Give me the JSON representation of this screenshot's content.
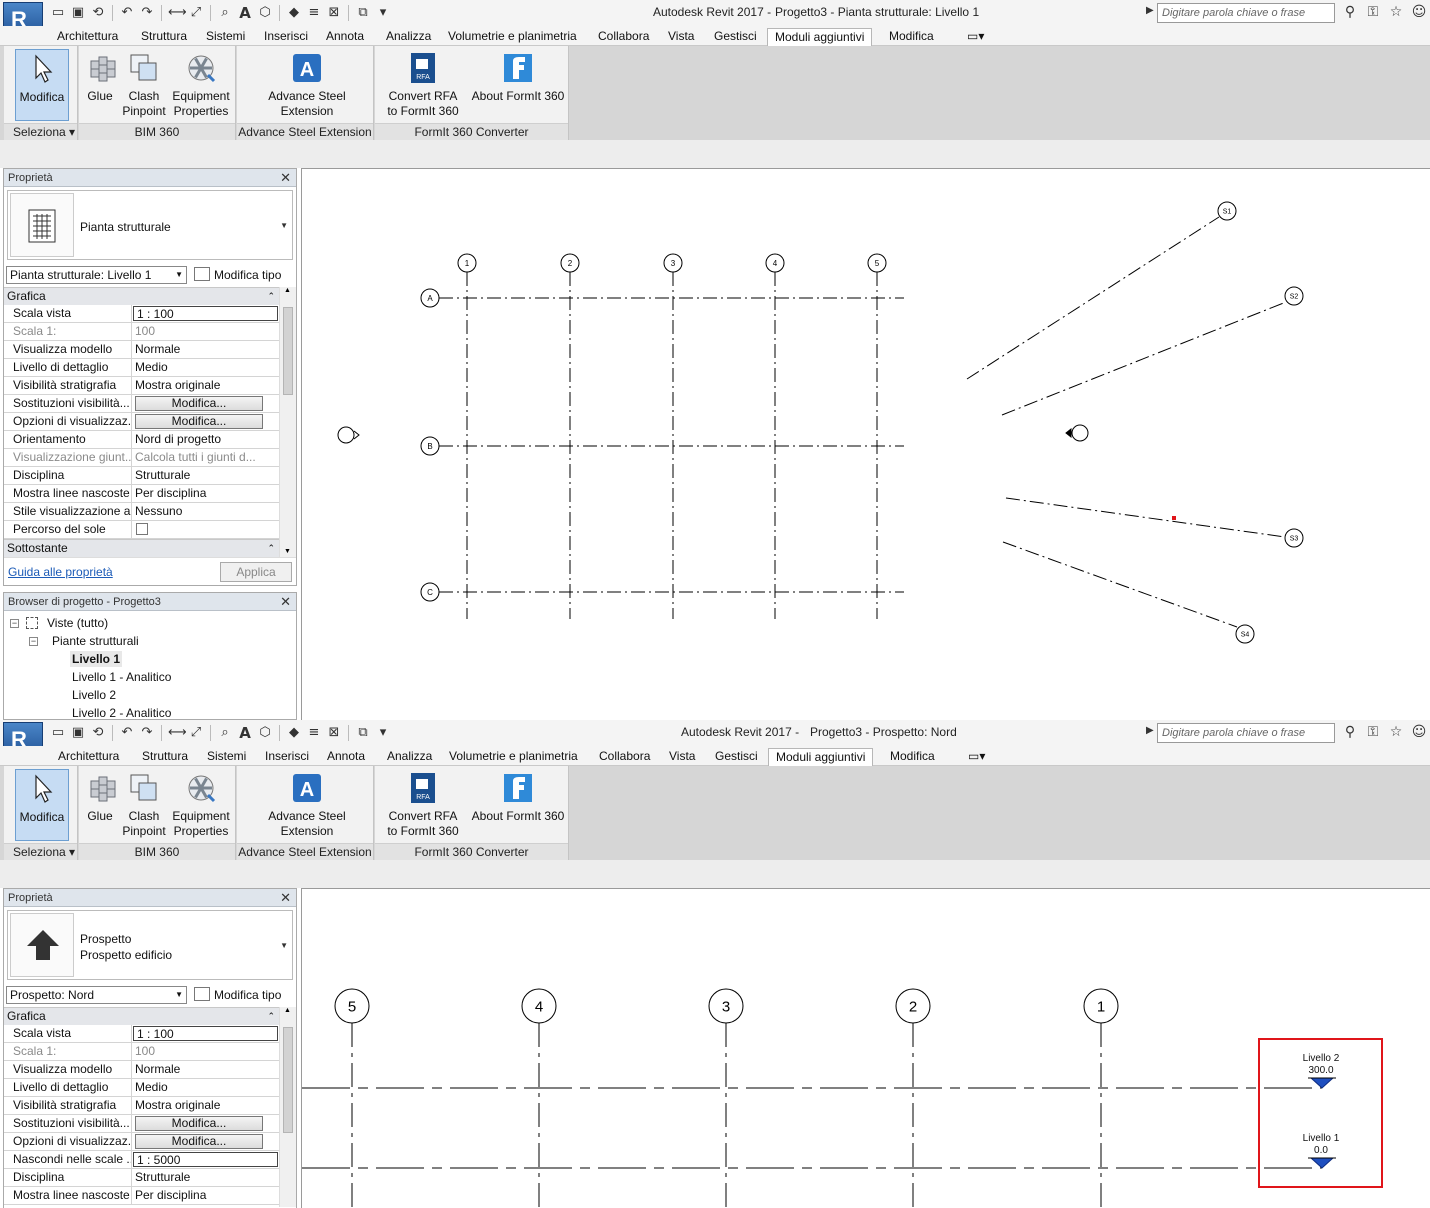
{
  "app": {
    "qat_icons": [
      "open-icon",
      "save-icon",
      "sync-icon",
      "undo-icon",
      "redo-icon",
      "measure-icon",
      "align-dimension-icon",
      "tag-icon",
      "text-icon",
      "3d-view-icon",
      "section-icon",
      "thin-lines-icon",
      "close-hidden-icon",
      "switch-windows-icon"
    ],
    "search_placeholder": "Digitare parola chiave o frase",
    "tabs": [
      "Architettura",
      "Struttura",
      "Sistemi",
      "Inserisci",
      "Annota",
      "Analizza",
      "Volumetrie e planimetria",
      "Collabora",
      "Vista",
      "Gestisci",
      "Moduli aggiuntivi",
      "Modifica"
    ],
    "active_tab": "Moduli aggiuntivi",
    "ribbon": {
      "modify": "Modifica",
      "select_panel": "Seleziona",
      "glue": "Glue",
      "clash_1": "Clash",
      "clash_2": "Pinpoint",
      "equip_1": "Equipment",
      "equip_2": "Properties",
      "bim360_panel": "BIM 360",
      "advsteel_1": "Advance Steel",
      "advsteel_2": "Extension",
      "advsteel_panel": "Advance Steel Extension",
      "convert_1": "Convert RFA",
      "convert_2": "to FormIt 360",
      "about": "About FormIt 360",
      "formit_panel": "FormIt 360 Converter"
    }
  },
  "top": {
    "title_app": "Autodesk Revit 2017 -",
    "title_doc": "Progetto3 - Pianta strutturale: Livello 1",
    "properties": {
      "header": "Proprietà",
      "type_name": "Pianta strutturale",
      "instance": "Pianta strutturale: Livello 1",
      "edit_type": "Modifica tipo",
      "group_graphics": "Grafica",
      "rows": [
        {
          "k": "Scala vista",
          "v": "1 : 100",
          "kind": "input"
        },
        {
          "k": "Scala 1:",
          "v": "100",
          "kind": "dis"
        },
        {
          "k": "Visualizza modello",
          "v": "Normale"
        },
        {
          "k": "Livello di dettaglio",
          "v": "Medio"
        },
        {
          "k": "Visibilità stratigrafia",
          "v": "Mostra originale"
        },
        {
          "k": "Sostituzioni visibilità...",
          "v": "Modifica...",
          "kind": "btn"
        },
        {
          "k": "Opzioni di visualizzaz...",
          "v": "Modifica...",
          "kind": "btn"
        },
        {
          "k": "Orientamento",
          "v": "Nord di progetto"
        },
        {
          "k": "Visualizzazione giunt...",
          "v": "Calcola tutti i giunti d...",
          "kind": "dis"
        },
        {
          "k": "Disciplina",
          "v": "Strutturale"
        },
        {
          "k": "Mostra linee nascoste",
          "v": "Per disciplina"
        },
        {
          "k": "Stile visualizzazione a...",
          "v": "Nessuno"
        },
        {
          "k": "Percorso del sole",
          "v": "",
          "kind": "chk"
        }
      ],
      "group_underlay": "Sottostante",
      "help_link": "Guida alle proprietà",
      "apply": "Applica"
    },
    "browser": {
      "header": "Browser di progetto - Progetto3",
      "views": "Viste (tutto)",
      "plans": "Piante strutturali",
      "items": [
        "Livello 1",
        "Livello 1 - Analitico",
        "Livello 2",
        "Livello 2 - Analitico"
      ]
    },
    "grid_cols": [
      "1",
      "2",
      "3",
      "4",
      "5"
    ],
    "grid_rows": [
      "A",
      "B",
      "C"
    ],
    "radial_grids": [
      "S1",
      "S2",
      "S3",
      "S4"
    ]
  },
  "bottom": {
    "title_app": "Autodesk Revit 2017 -",
    "title_doc": "Progetto3 - Prospetto: Nord",
    "properties": {
      "header": "Proprietà",
      "type_line1": "Prospetto",
      "type_line2": "Prospetto edificio",
      "instance": "Prospetto: Nord",
      "edit_type": "Modifica tipo",
      "group_graphics": "Grafica",
      "rows": [
        {
          "k": "Scala vista",
          "v": "1 : 100",
          "kind": "input"
        },
        {
          "k": "Scala 1:",
          "v": "100",
          "kind": "dis"
        },
        {
          "k": "Visualizza modello",
          "v": "Normale"
        },
        {
          "k": "Livello di dettaglio",
          "v": "Medio"
        },
        {
          "k": "Visibilità stratigrafia",
          "v": "Mostra originale"
        },
        {
          "k": "Sostituzioni visibilità...",
          "v": "Modifica...",
          "kind": "btn"
        },
        {
          "k": "Opzioni di visualizzaz...",
          "v": "Modifica...",
          "kind": "btn"
        },
        {
          "k": "Nascondi nelle scale ...",
          "v": "1 : 5000",
          "kind": "input"
        },
        {
          "k": "Disciplina",
          "v": "Strutturale"
        },
        {
          "k": "Mostra linee nascoste",
          "v": "Per disciplina"
        }
      ]
    },
    "grid_heads": [
      "5",
      "4",
      "3",
      "2",
      "1"
    ],
    "levels": [
      {
        "name": "Livello 2",
        "elev": "300.0"
      },
      {
        "name": "Livello 1",
        "elev": "0.0"
      }
    ]
  }
}
